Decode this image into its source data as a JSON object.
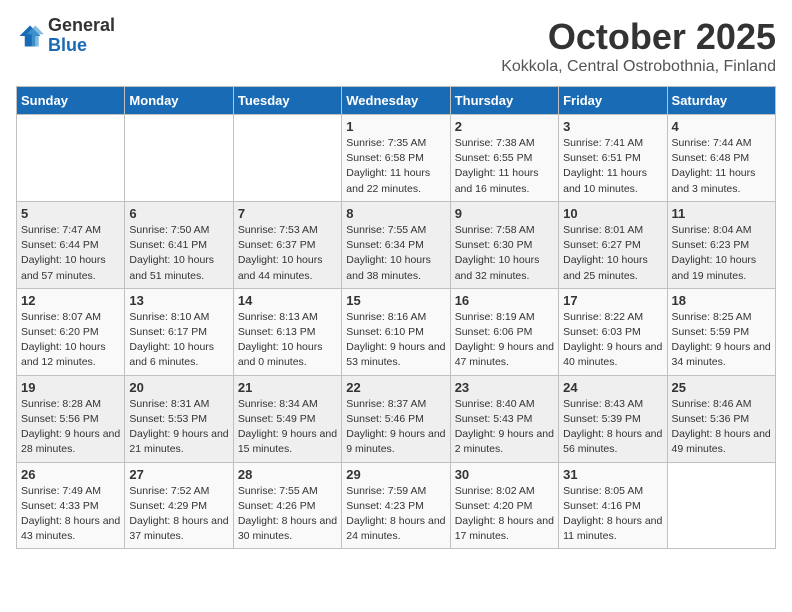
{
  "header": {
    "logo_general": "General",
    "logo_blue": "Blue",
    "month": "October 2025",
    "location": "Kokkola, Central Ostrobothnia, Finland"
  },
  "weekdays": [
    "Sunday",
    "Monday",
    "Tuesday",
    "Wednesday",
    "Thursday",
    "Friday",
    "Saturday"
  ],
  "weeks": [
    [
      {
        "day": "",
        "info": ""
      },
      {
        "day": "",
        "info": ""
      },
      {
        "day": "",
        "info": ""
      },
      {
        "day": "1",
        "info": "Sunrise: 7:35 AM\nSunset: 6:58 PM\nDaylight: 11 hours\nand 22 minutes."
      },
      {
        "day": "2",
        "info": "Sunrise: 7:38 AM\nSunset: 6:55 PM\nDaylight: 11 hours\nand 16 minutes."
      },
      {
        "day": "3",
        "info": "Sunrise: 7:41 AM\nSunset: 6:51 PM\nDaylight: 11 hours\nand 10 minutes."
      },
      {
        "day": "4",
        "info": "Sunrise: 7:44 AM\nSunset: 6:48 PM\nDaylight: 11 hours\nand 3 minutes."
      }
    ],
    [
      {
        "day": "5",
        "info": "Sunrise: 7:47 AM\nSunset: 6:44 PM\nDaylight: 10 hours\nand 57 minutes."
      },
      {
        "day": "6",
        "info": "Sunrise: 7:50 AM\nSunset: 6:41 PM\nDaylight: 10 hours\nand 51 minutes."
      },
      {
        "day": "7",
        "info": "Sunrise: 7:53 AM\nSunset: 6:37 PM\nDaylight: 10 hours\nand 44 minutes."
      },
      {
        "day": "8",
        "info": "Sunrise: 7:55 AM\nSunset: 6:34 PM\nDaylight: 10 hours\nand 38 minutes."
      },
      {
        "day": "9",
        "info": "Sunrise: 7:58 AM\nSunset: 6:30 PM\nDaylight: 10 hours\nand 32 minutes."
      },
      {
        "day": "10",
        "info": "Sunrise: 8:01 AM\nSunset: 6:27 PM\nDaylight: 10 hours\nand 25 minutes."
      },
      {
        "day": "11",
        "info": "Sunrise: 8:04 AM\nSunset: 6:23 PM\nDaylight: 10 hours\nand 19 minutes."
      }
    ],
    [
      {
        "day": "12",
        "info": "Sunrise: 8:07 AM\nSunset: 6:20 PM\nDaylight: 10 hours\nand 12 minutes."
      },
      {
        "day": "13",
        "info": "Sunrise: 8:10 AM\nSunset: 6:17 PM\nDaylight: 10 hours\nand 6 minutes."
      },
      {
        "day": "14",
        "info": "Sunrise: 8:13 AM\nSunset: 6:13 PM\nDaylight: 10 hours\nand 0 minutes."
      },
      {
        "day": "15",
        "info": "Sunrise: 8:16 AM\nSunset: 6:10 PM\nDaylight: 9 hours\nand 53 minutes."
      },
      {
        "day": "16",
        "info": "Sunrise: 8:19 AM\nSunset: 6:06 PM\nDaylight: 9 hours\nand 47 minutes."
      },
      {
        "day": "17",
        "info": "Sunrise: 8:22 AM\nSunset: 6:03 PM\nDaylight: 9 hours\nand 40 minutes."
      },
      {
        "day": "18",
        "info": "Sunrise: 8:25 AM\nSunset: 5:59 PM\nDaylight: 9 hours\nand 34 minutes."
      }
    ],
    [
      {
        "day": "19",
        "info": "Sunrise: 8:28 AM\nSunset: 5:56 PM\nDaylight: 9 hours\nand 28 minutes."
      },
      {
        "day": "20",
        "info": "Sunrise: 8:31 AM\nSunset: 5:53 PM\nDaylight: 9 hours\nand 21 minutes."
      },
      {
        "day": "21",
        "info": "Sunrise: 8:34 AM\nSunset: 5:49 PM\nDaylight: 9 hours\nand 15 minutes."
      },
      {
        "day": "22",
        "info": "Sunrise: 8:37 AM\nSunset: 5:46 PM\nDaylight: 9 hours\nand 9 minutes."
      },
      {
        "day": "23",
        "info": "Sunrise: 8:40 AM\nSunset: 5:43 PM\nDaylight: 9 hours\nand 2 minutes."
      },
      {
        "day": "24",
        "info": "Sunrise: 8:43 AM\nSunset: 5:39 PM\nDaylight: 8 hours\nand 56 minutes."
      },
      {
        "day": "25",
        "info": "Sunrise: 8:46 AM\nSunset: 5:36 PM\nDaylight: 8 hours\nand 49 minutes."
      }
    ],
    [
      {
        "day": "26",
        "info": "Sunrise: 7:49 AM\nSunset: 4:33 PM\nDaylight: 8 hours\nand 43 minutes."
      },
      {
        "day": "27",
        "info": "Sunrise: 7:52 AM\nSunset: 4:29 PM\nDaylight: 8 hours\nand 37 minutes."
      },
      {
        "day": "28",
        "info": "Sunrise: 7:55 AM\nSunset: 4:26 PM\nDaylight: 8 hours\nand 30 minutes."
      },
      {
        "day": "29",
        "info": "Sunrise: 7:59 AM\nSunset: 4:23 PM\nDaylight: 8 hours\nand 24 minutes."
      },
      {
        "day": "30",
        "info": "Sunrise: 8:02 AM\nSunset: 4:20 PM\nDaylight: 8 hours\nand 17 minutes."
      },
      {
        "day": "31",
        "info": "Sunrise: 8:05 AM\nSunset: 4:16 PM\nDaylight: 8 hours\nand 11 minutes."
      },
      {
        "day": "",
        "info": ""
      }
    ]
  ]
}
